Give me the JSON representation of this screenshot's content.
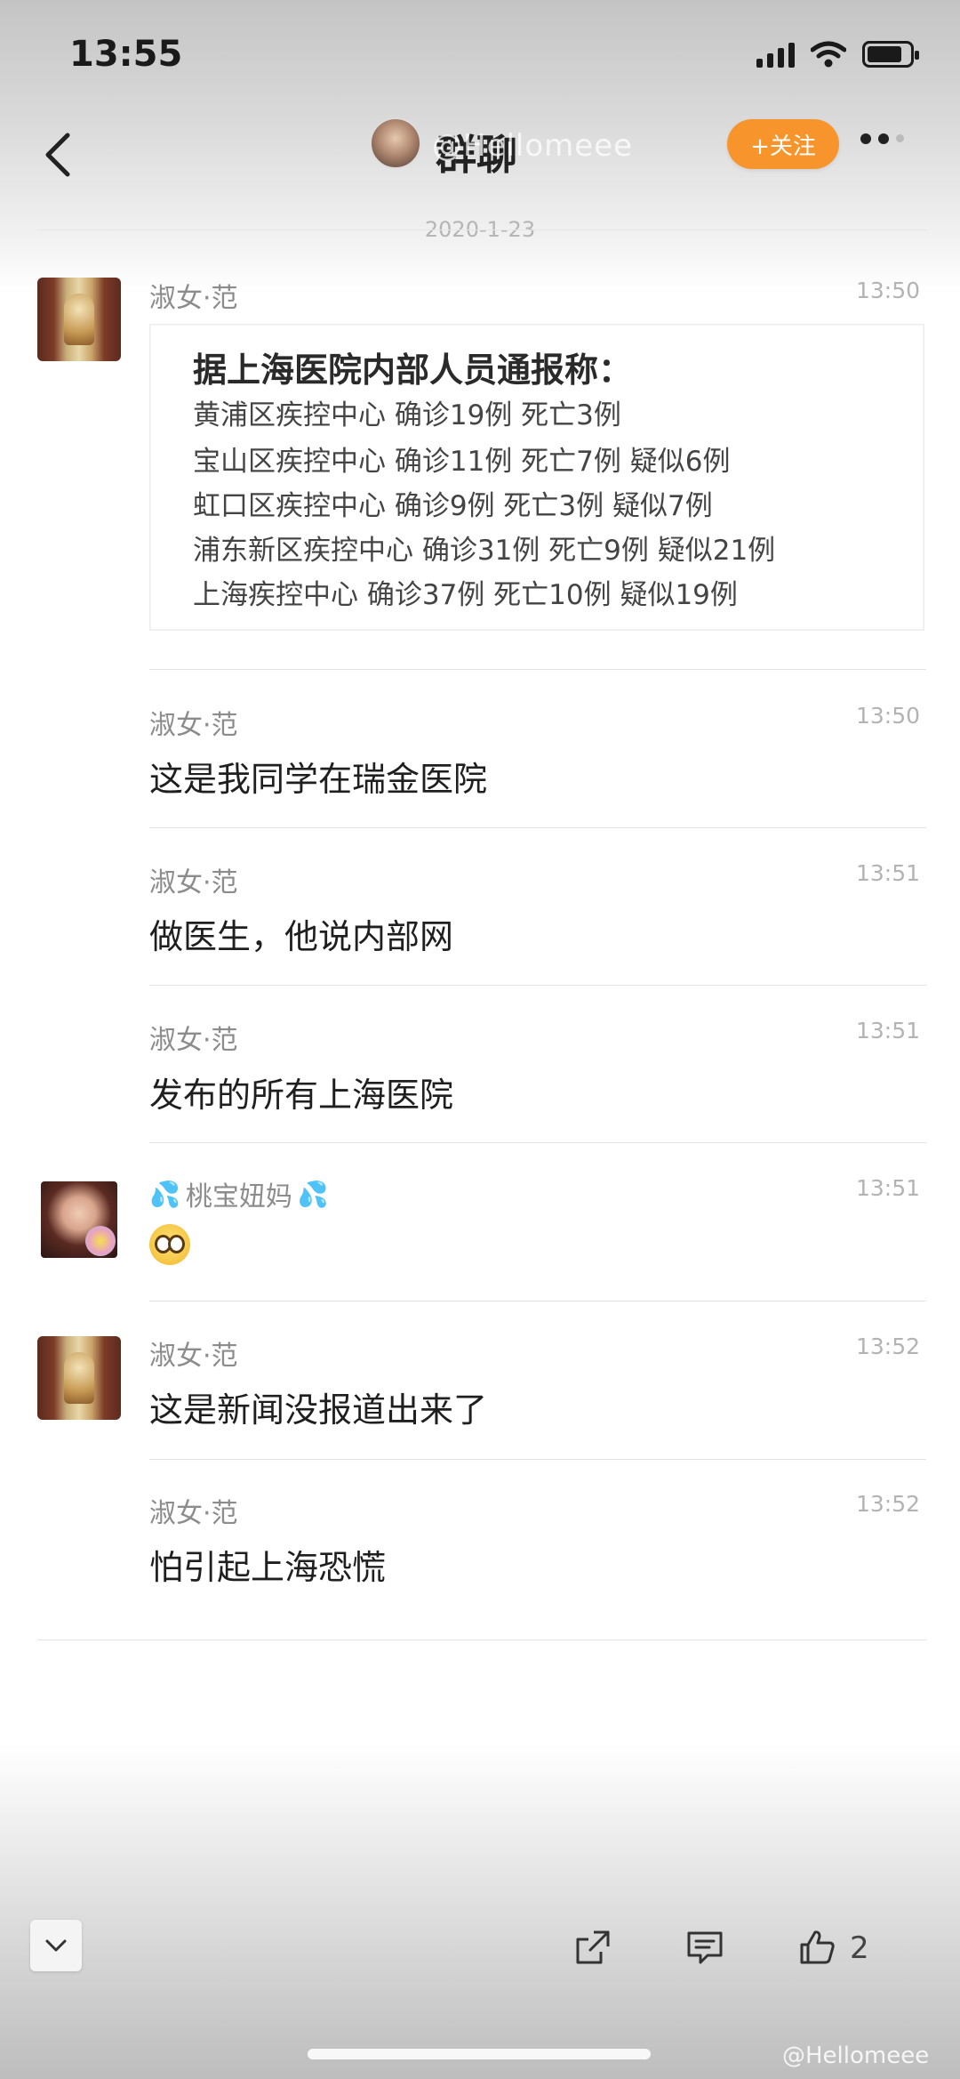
{
  "status_bar": {
    "time": "13:55"
  },
  "nav": {
    "title": "群聊",
    "watermark": "@Hellomeee",
    "follow_label": "+关注"
  },
  "date": "2020-1-23",
  "card": {
    "heading": "据上海医院内部人员通报称：",
    "rows": [
      "黄浦区疾控中心 确诊19例 死亡3例",
      "宝山区疾控中心 确诊11例 死亡7例 疑似6例",
      "虹口区疾控中心 确诊9例  死亡3例 疑似7例",
      "浦东新区疾控中心 确诊31例 死亡9例 疑似21例",
      "上海疾控中心 确诊37例 死亡10例 疑似19例"
    ]
  },
  "messages": [
    {
      "sender": "淑女·范",
      "time": "13:50",
      "text": ""
    },
    {
      "sender": "淑女·范",
      "time": "13:50",
      "text": "这是我同学在瑞金医院"
    },
    {
      "sender": "淑女·范",
      "time": "13:51",
      "text": "做医生，他说内部网"
    },
    {
      "sender": "淑女·范",
      "time": "13:51",
      "text": "发布的所有上海医院"
    },
    {
      "sender": "桃宝妞妈",
      "time": "13:51",
      "text": ""
    },
    {
      "sender": "淑女·范",
      "time": "13:52",
      "text": "这是新闻没报道出来了"
    },
    {
      "sender": "淑女·范",
      "time": "13:52",
      "text": "怕引起上海恐慌"
    }
  ],
  "toolbar": {
    "like_count": "2",
    "watermark": "@Hellomeee"
  },
  "icons": {
    "back": "chevron-left-icon",
    "share": "share-icon",
    "comment": "comment-icon",
    "like": "thumbs-up-icon",
    "collapse": "chevron-down-icon"
  },
  "colors": {
    "accent": "#f7952c",
    "secondary_text": "#8c8c8c"
  }
}
